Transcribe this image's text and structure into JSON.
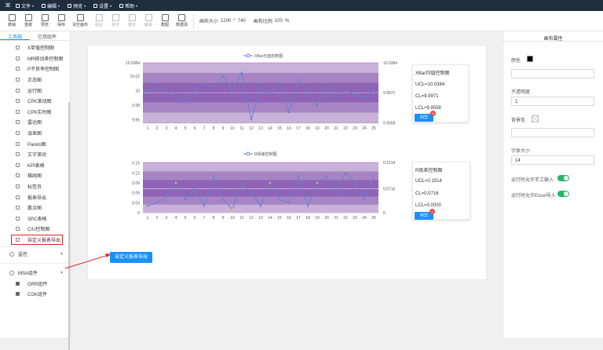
{
  "menu": {
    "logo": "⌘",
    "items": [
      {
        "label": "文件",
        "icon": "file-icon"
      },
      {
        "label": "编辑",
        "icon": "edit-icon"
      },
      {
        "label": "预览",
        "icon": "preview-icon"
      },
      {
        "label": "设置",
        "icon": "settings-icon"
      },
      {
        "label": "帮助",
        "icon": "help-icon"
      }
    ]
  },
  "toolbar": {
    "buttons": [
      {
        "label": "撤销",
        "icon": "undo-icon",
        "enabled": true
      },
      {
        "label": "重做",
        "icon": "redo-icon",
        "enabled": true
      },
      {
        "label": "预览",
        "icon": "preview-icon",
        "enabled": true
      },
      {
        "label": "保存",
        "icon": "save-icon",
        "enabled": true
      },
      {
        "label": "清空画布",
        "icon": "clear-canvas-icon",
        "enabled": true
      },
      {
        "label": "组合",
        "icon": "group-icon",
        "enabled": false
      },
      {
        "label": "拆分",
        "icon": "ungroup-icon",
        "enabled": false
      },
      {
        "label": "锁定",
        "icon": "lock-icon",
        "enabled": false
      },
      {
        "label": "解锁",
        "icon": "unlock-icon",
        "enabled": false
      },
      {
        "label": "截图",
        "icon": "screenshot-icon",
        "enabled": true
      },
      {
        "label": "数据源",
        "icon": "database-icon",
        "enabled": true
      }
    ],
    "canvas_size_label": "画布大小",
    "canvas_width": "1200",
    "canvas_sep": "*",
    "canvas_height": "740",
    "canvas_ratio_label": "画布比例",
    "canvas_ratio": "100",
    "canvas_ratio_unit": "%"
  },
  "left_panel": {
    "tabs": [
      {
        "label": "工具箱",
        "active": true
      },
      {
        "label": "已用组件",
        "active": false
      }
    ],
    "components": [
      {
        "label": "X单值控制图",
        "icon": "list-icon"
      },
      {
        "label": "MR移动差控制图",
        "icon": "list-icon"
      },
      {
        "label": "P不良率控制图",
        "icon": "list-icon"
      },
      {
        "label": "正态图",
        "icon": "triangle-icon"
      },
      {
        "label": "运行图",
        "icon": "line-icon"
      },
      {
        "label": "CPK滚动图",
        "icon": "chart-icon"
      },
      {
        "label": "CPK实时图",
        "icon": "chart-icon"
      },
      {
        "label": "雷达图",
        "icon": "radar-icon"
      },
      {
        "label": "误差图",
        "icon": "error-icon"
      },
      {
        "label": "Pareto图",
        "icon": "pareto-icon"
      },
      {
        "label": "文字滚动",
        "icon": "text-scroll-icon"
      },
      {
        "label": "KPI表格",
        "icon": "table-icon"
      },
      {
        "label": "箱线图",
        "icon": "boxplot-icon"
      },
      {
        "label": "标签页",
        "icon": "tabs-icon"
      },
      {
        "label": "报表导出",
        "icon": "export-icon"
      },
      {
        "label": "散点图",
        "icon": "scatter-icon"
      },
      {
        "label": "SPC表格",
        "icon": "table-icon"
      },
      {
        "label": "C/U控制图",
        "icon": "chart-icon"
      },
      {
        "label": "自定义报表导出",
        "icon": "export-icon"
      }
    ],
    "groups": [
      {
        "label": "监控",
        "icon": "eye-icon"
      },
      {
        "label": "MSA组件",
        "icon": "share-icon"
      }
    ],
    "msa_components": [
      {
        "label": "GRR组件",
        "icon": "grr-icon"
      },
      {
        "label": "CGK组件",
        "icon": "cgk-icon"
      }
    ]
  },
  "canvas": {
    "export_button": "自定义报表导出"
  },
  "xbar_card": {
    "title": "XBar均值控制图",
    "ucl": "UCL=10.0384",
    "cl": "CL=9.9971",
    "lcl": "LCL=9.9558",
    "button": "判异",
    "badge": "9"
  },
  "r_card": {
    "title": "R极差控制图",
    "ucl": "UCL=0.1514",
    "cl": "CL=0.0716",
    "lcl": "LCL=0.0000",
    "button": "判异",
    "badge": "1"
  },
  "right_panel": {
    "title": "画布属性",
    "color_label": "颜色",
    "color_value": "#000000",
    "color_input": "",
    "opacity_label": "不透明度",
    "opacity_value": "1",
    "bg_label": "背景色",
    "bg_input": "",
    "fontsize_label": "字体大小",
    "fontsize_value": "14",
    "manual_label": "运行时允许手工输入",
    "excel_label": "运行时允许Excel导入",
    "manual_on": true,
    "excel_on": true
  },
  "chart_data": [
    {
      "type": "line",
      "title": "",
      "series": [
        {
          "name": "XBar均值控制图",
          "values": [
            10.0,
            10.005,
            10.0,
            9.99,
            9.985,
            10.0,
            10.01,
            10.005,
            10.02,
            10.0,
            10.025,
            9.96,
            10.005,
            9.995,
            10.01,
            9.97,
            10.015,
            10.0,
            9.98,
            10.005,
            9.99,
            10.0,
            9.995,
            9.99,
            10.0
          ]
        }
      ],
      "categories": [
        "1",
        "2",
        "3",
        "4",
        "5",
        "6",
        "7",
        "8",
        "9",
        "10",
        "11",
        "12",
        "13",
        "14",
        "15",
        "16",
        "17",
        "18",
        "19",
        "20",
        "21",
        "22",
        "23",
        "24",
        "25"
      ],
      "yticks_left": [
        "10.0384",
        "10.02",
        "10",
        "9.98",
        "9.96"
      ],
      "yticks_right": [
        "10.0384",
        "9.9971",
        "9.9558"
      ],
      "ylim": [
        9.955,
        10.0384
      ],
      "ucl": 10.0384,
      "cl": 9.9971,
      "lcl": 9.9558
    },
    {
      "type": "line",
      "title": "",
      "series": [
        {
          "name": "R极差控制图",
          "values": [
            0.02,
            0.03,
            0.05,
            0.09,
            0.04,
            0.07,
            0.02,
            0.11,
            0.04,
            0.01,
            0.09,
            0.06,
            0.02,
            0.09,
            0.04,
            0.03,
            0.11,
            0.02,
            0.09,
            0.11,
            0.06,
            0.12,
            0.09,
            0.04,
            0.11
          ]
        }
      ],
      "categories": [
        "1",
        "2",
        "3",
        "4",
        "5",
        "6",
        "7",
        "8",
        "9",
        "10",
        "11",
        "12",
        "13",
        "14",
        "15",
        "16",
        "17",
        "18",
        "19",
        "20",
        "21",
        "22",
        "23",
        "24",
        "25"
      ],
      "yticks_left": [
        "0.15",
        "0.12",
        "0.09",
        "0.06",
        "0.03",
        "0"
      ],
      "yticks_right": [
        "0.1514",
        "0.0716",
        "0"
      ],
      "ylim": [
        0,
        0.1514
      ],
      "ucl": 0.1514,
      "cl": 0.0716,
      "lcl": 0
    }
  ]
}
